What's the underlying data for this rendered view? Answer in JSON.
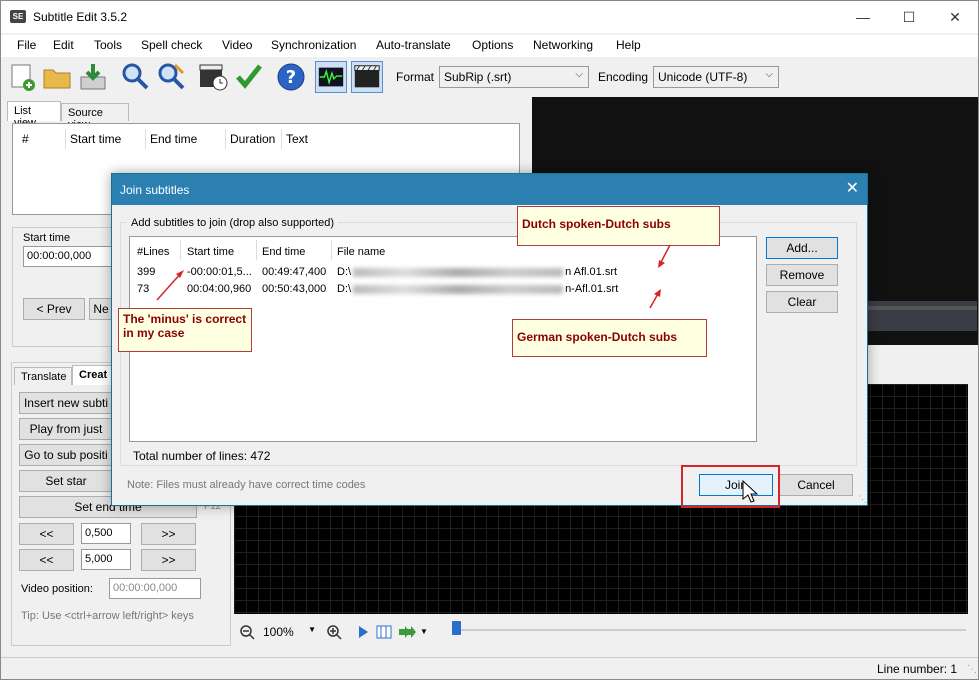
{
  "app": {
    "title": "Subtitle Edit 3.5.2",
    "icon_label": "SE"
  },
  "menu": [
    "File",
    "Edit",
    "Tools",
    "Spell check",
    "Video",
    "Synchronization",
    "Auto-translate",
    "Options",
    "Networking",
    "Help"
  ],
  "toolbar": {
    "format_label": "Format",
    "format_value": "SubRip (.srt)",
    "encoding_label": "Encoding",
    "encoding_value": "Unicode (UTF-8)",
    "icons": [
      "new-file-icon",
      "open-folder-icon",
      "download-icon",
      "find-icon",
      "replace-icon",
      "visual-sync-icon",
      "spell-check-icon",
      "help-icon",
      "waveform-icon",
      "video-icon"
    ]
  },
  "main": {
    "tabs": [
      "List view",
      "Source view"
    ],
    "columns": [
      "#",
      "Start time",
      "End time",
      "Duration",
      "Text"
    ],
    "start_time_label": "Start time",
    "start_time_value": "00:00:00,000",
    "prev_button": "< Prev",
    "next_button": "Ne"
  },
  "left_panel": {
    "tabs": [
      "Translate",
      "Creat"
    ],
    "buttons": [
      "Insert new subti",
      "Play from just",
      "Go to sub positi",
      "Set star",
      "Set end time"
    ],
    "shortcut_hint": "F12",
    "step_small": "0,500",
    "step_large": "5,000",
    "back_label": "<<",
    "fwd_label": ">>",
    "video_position_label": "Video position:",
    "video_position_value": "00:00:00,000",
    "tip": "Tip: Use <ctrl+arrow left/right> keys"
  },
  "waveform": {
    "zoom": "100%"
  },
  "status": {
    "line_number": "Line number: 1"
  },
  "dialog": {
    "title": "Join subtitles",
    "group_label": "Add subtitles to join (drop also supported)",
    "columns": [
      "#Lines",
      "Start time",
      "End time",
      "File name"
    ],
    "rows": [
      {
        "lines": "399",
        "start": "-00:00:01,5...",
        "end": "00:49:47,400",
        "file_prefix": "D:\\",
        "file_suffix": "n Afl.01.srt"
      },
      {
        "lines": "73",
        "start": "00:04:00,960",
        "end": "00:50:43,000",
        "file_prefix": "D:\\",
        "file_suffix": "n-Afl.01.srt"
      }
    ],
    "add_button": "Add...",
    "remove_button": "Remove",
    "clear_button": "Clear",
    "total_lines": "Total number of lines: 472",
    "note": "Note: Files must already have correct time codes",
    "join_button": "Join",
    "cancel_button": "Cancel"
  },
  "annotations": {
    "dutch": "Dutch spoken-Dutch subs",
    "german": "German spoken-Dutch subs",
    "minus": "The 'minus' is correct in my case"
  }
}
